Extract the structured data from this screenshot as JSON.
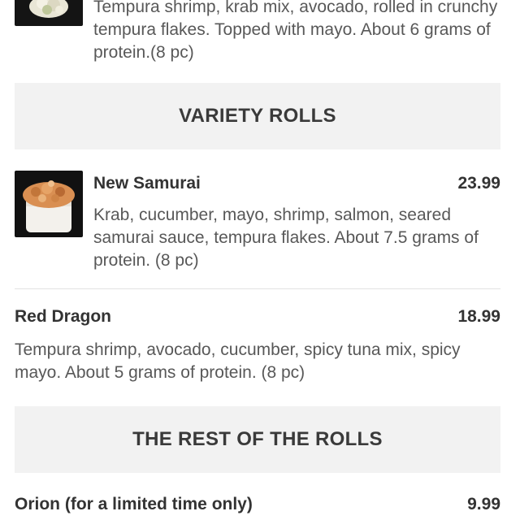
{
  "top_item": {
    "description": "Tempura shrimp, krab mix, avocado, rolled in crunchy tempura flakes. Topped with mayo. About 6 grams of protein.(8 pc)",
    "image": "sushi-roll-photo"
  },
  "sections": {
    "variety": "VARIETY ROLLS",
    "rest": "THE REST OF THE ROLLS"
  },
  "items": {
    "new_samurai": {
      "name": "New Samurai",
      "price": "23.99",
      "description": "Krab, cucumber, mayo, shrimp, salmon, seared samurai sauce, tempura flakes. About 7.5 grams of protein. (8 pc)",
      "image": "new-samurai-photo"
    },
    "red_dragon": {
      "name": "Red Dragon",
      "price": "18.99",
      "description": "Tempura shrimp, avocado, cucumber, spicy tuna mix, spicy mayo. About 5 grams of protein. (8 pc)"
    },
    "orion": {
      "name": "Orion (for a limited time only)",
      "price": "9.99"
    }
  }
}
